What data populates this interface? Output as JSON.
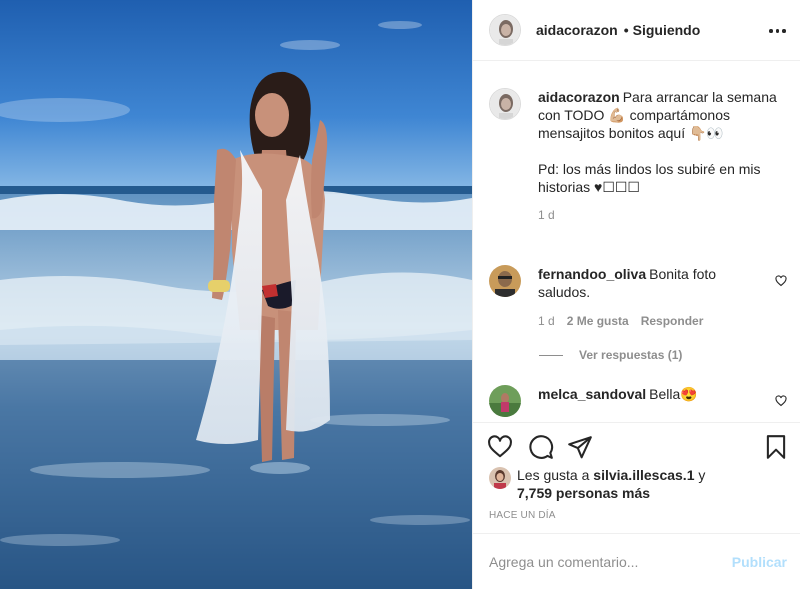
{
  "post": {
    "author": "aidacorazon",
    "dot": "•",
    "follow_status": "Siguiendo"
  },
  "caption": {
    "author": "aidacorazon",
    "line1": "Para arrancar la semana con TODO 💪🏼 compartámonos mensajitos bonitos aquí 👇🏼👀",
    "line2": "Pd: los más lindos los subiré en mis historias ♥︎☐☐☐",
    "time": "1 d"
  },
  "comments": [
    {
      "author": "fernandoo_oliva",
      "text": "Bonita foto saludos.",
      "time": "1 d",
      "likes": "2 Me gusta",
      "reply": "Responder",
      "view_replies": "Ver respuestas (1)"
    },
    {
      "author": "melca_sandoval",
      "text": "Bella😍"
    }
  ],
  "likes": {
    "prefix": "Les gusta a",
    "user": "silvia.illescas.1",
    "conj": "y",
    "others": "7,759 personas más"
  },
  "timestamp": "HACE UN DÍA",
  "composer": {
    "placeholder": "Agrega un comentario...",
    "publish": "Publicar"
  },
  "icons": {
    "more": "more-horizontal-icon",
    "like": "heart-icon",
    "comment": "comment-bubble-icon",
    "share": "paper-plane-icon",
    "save": "bookmark-icon"
  },
  "colors": {
    "text": "#262626",
    "secondary": "#8e8e8e",
    "border": "#efefef",
    "publish_disabled": "#b2dffc"
  }
}
